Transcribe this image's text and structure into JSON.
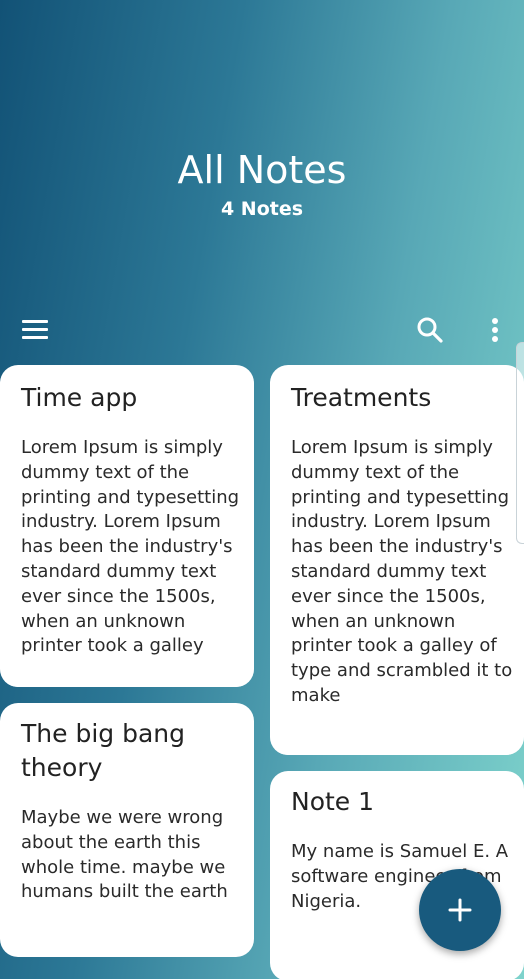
{
  "header": {
    "title": "All Notes",
    "subtitle": "4 Notes"
  },
  "toolbar": {
    "menu_icon": "hamburger-menu-icon",
    "search_icon": "search-icon",
    "more_icon": "more-vertical-icon"
  },
  "notes": [
    {
      "title": "Time app",
      "body": "Lorem Ipsum is simply dummy text of the printing and typesetting industry. Lorem Ipsum has been the industry's standard dummy text ever since the 1500s, when an unknown printer took a galley"
    },
    {
      "title": "Treatments",
      "body": "Lorem Ipsum is simply dummy text of the printing and typesetting industry. Lorem Ipsum has been the industry's standard dummy text ever since the 1500s, when an unknown printer took a galley of type and scrambled it to make"
    },
    {
      "title": "The big bang theory",
      "body": "Maybe we were wrong about the earth this whole time. maybe we humans built the earth"
    },
    {
      "title": "Note 1",
      "body": "My name is Samuel E. A software engineer from Nigeria."
    }
  ],
  "fab": {
    "icon": "plus-icon"
  },
  "colors": {
    "gradient_start": "#125276",
    "gradient_end": "#7ed3cc",
    "fab": "#185a7e",
    "card": "#ffffff"
  }
}
